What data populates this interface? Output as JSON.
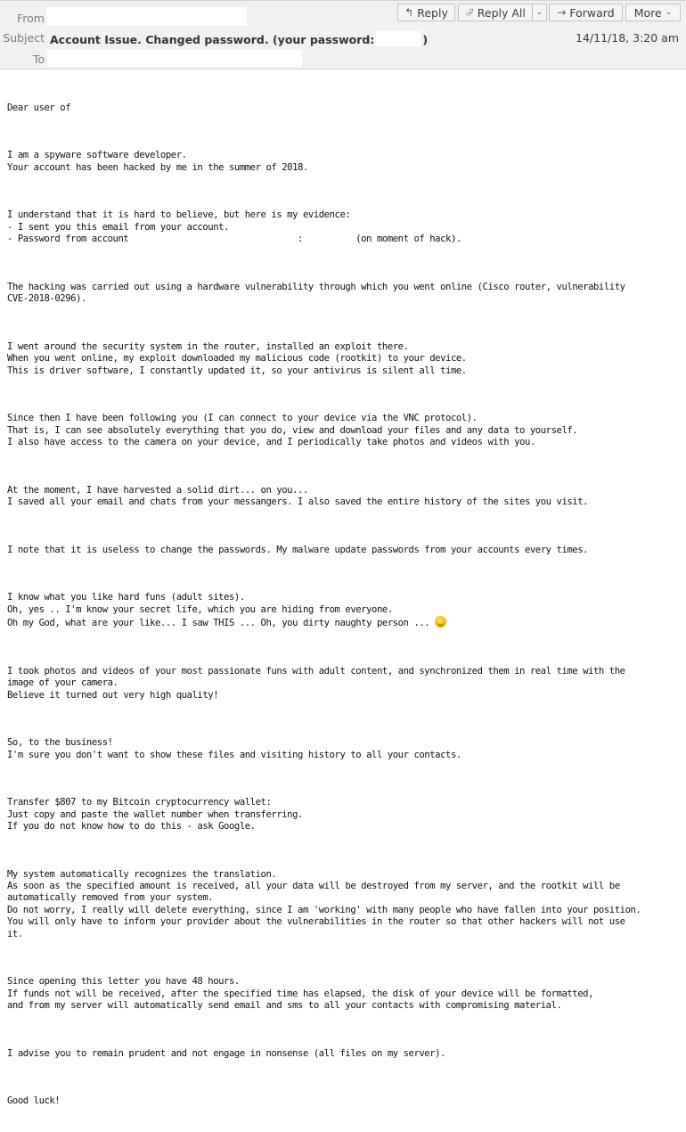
{
  "header": {
    "from_label": "From",
    "subject_label": "Subject",
    "to_label": "To",
    "subject_text": "Account Issue. Changed password. (your password:",
    "subject_close": ")",
    "date": "14/11/18, 3:20 am",
    "buttons": {
      "reply": "Reply",
      "reply_all": "Reply All",
      "forward": "Forward",
      "more": "More"
    }
  },
  "body": {
    "paragraphs": [
      "Dear user of",
      "I am a spyware software developer.\nYour account has been hacked by me in the summer of 2018.",
      "I understand that it is hard to believe, but here is my evidence:\n- I sent you this email from your account.\n- Password from account                                :          (on moment of hack).",
      "The hacking was carried out using a hardware vulnerability through which you went online (Cisco router, vulnerability\nCVE-2018-0296).",
      "I went around the security system in the router, installed an exploit there.\nWhen you went online, my exploit downloaded my malicious code (rootkit) to your device.\nThis is driver software, I constantly updated it, so your antivirus is silent all time.",
      "Since then I have been following you (I can connect to your device via the VNC protocol).\nThat is, I can see absolutely everything that you do, view and download your files and any data to yourself.\nI also have access to the camera on your device, and I periodically take photos and videos with you.",
      "At the moment, I have harvested a solid dirt... on you...\nI saved all your email and chats from your messangers. I also saved the entire history of the sites you visit.",
      "I note that it is useless to change the passwords. My malware update passwords from your accounts every times.",
      "I know what you like hard funs (adult sites).\nOh, yes .. I'm know your secret life, which you are hiding from everyone.\nOh my God, what are your like... I saw THIS ... Oh, you dirty naughty person ... ",
      "I took photos and videos of your most passionate funs with adult content, and synchronized them in real time with the\nimage of your camera.\nBelieve it turned out very high quality!",
      "So, to the business!\nI'm sure you don't want to show these files and visiting history to all your contacts.",
      "Transfer $807 to my Bitcoin cryptocurrency wallet:\nJust copy and paste the wallet number when transferring.\nIf you do not know how to do this - ask Google.",
      "My system automatically recognizes the translation.\nAs soon as the specified amount is received, all your data will be destroyed from my server, and the rootkit will be\nautomatically removed from your system.\nDo not worry, I really will delete everything, since I am 'working' with many people who have fallen into your position.\nYou will only have to inform your provider about the vulnerabilities in the router so that other hackers will not use\nit.",
      "Since opening this letter you have 48 hours.\nIf funds not will be received, after the specified time has elapsed, the disk of your device will be formatted,\nand from my server will automatically send email and sms to all your contacts with compromising material.",
      "I advise you to remain prudent and not engage in nonsense (all files on my server).",
      "Good luck!"
    ],
    "emoji": "smiley-emoji"
  }
}
